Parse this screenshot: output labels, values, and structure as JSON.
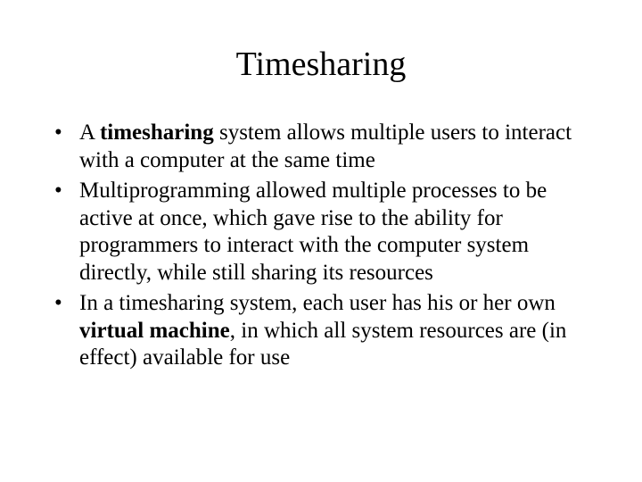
{
  "slide": {
    "title": "Timesharing",
    "bullets": [
      {
        "pre": "A ",
        "bold": "timesharing",
        "post": " system allows multiple users to interact with a computer at the same time"
      },
      {
        "pre": "Multiprogramming allowed multiple processes to be active at once, which gave rise to the ability for programmers to interact with the computer system directly, while still sharing its resources",
        "bold": "",
        "post": ""
      },
      {
        "pre": "In a timesharing system, each user has his or her own ",
        "bold": "virtual machine",
        "post": ", in which all system resources are (in effect) available for use"
      }
    ]
  }
}
